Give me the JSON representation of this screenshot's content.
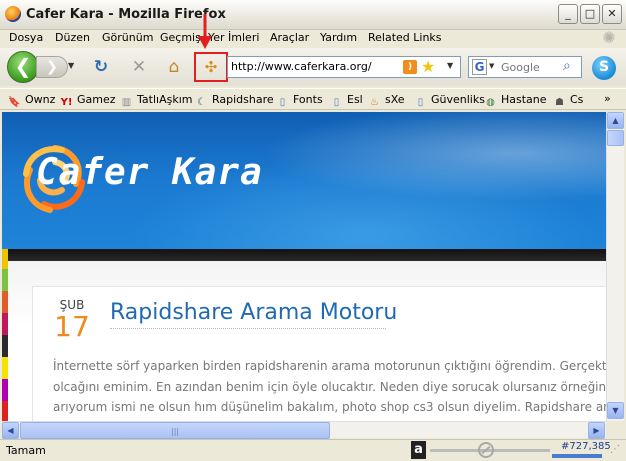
{
  "window": {
    "title": "Cafer Kara - Mozilla Firefox",
    "min": "_",
    "max": "□",
    "close": "✕"
  },
  "menu": [
    "Dosya",
    "Düzen",
    "Görünüm",
    "Geçmiş",
    "Yer İmleri",
    "Araçlar",
    "Yardım",
    "Related Links"
  ],
  "nav": {
    "back": "❮",
    "forward": "❯",
    "dropdown": "▼",
    "reload": "↻",
    "stop": "✕",
    "home": "⌂",
    "url": "http://www.caferkara.org/",
    "rss": ")",
    "star": "★",
    "search_engine": "G",
    "search_placeholder": "Google",
    "search_icon": "⌕",
    "skype": "S"
  },
  "bookmarks": [
    {
      "label": "Ownz",
      "icon": "bookmark-icon"
    },
    {
      "label": "Gamez",
      "icon": "yahoo-icon"
    },
    {
      "label": "TatlıAşkım",
      "icon": "folder-icon"
    },
    {
      "label": "Rapidshare",
      "icon": "moon-icon"
    },
    {
      "label": "Fonts",
      "icon": "page-icon"
    },
    {
      "label": "Esl",
      "icon": "page-icon"
    },
    {
      "label": "sXe",
      "icon": "flame-icon"
    },
    {
      "label": "Güvenliks",
      "icon": "page-icon"
    },
    {
      "label": "Hastane",
      "icon": "globe-icon"
    },
    {
      "label": "Cs",
      "icon": "cs-icon"
    }
  ],
  "bookmarks_more": "»",
  "site": {
    "title": "Cafer Kara",
    "post": {
      "month": "ŞUB",
      "day": "17",
      "title": "Rapidshare Arama Motoru",
      "lines": [
        "İnternette sörf yaparken birden rapidsharenin arama motorunun çıktığını öğrendim. Gerçekten fay",
        "olcağını eminim. En azından benim için öyle olucaktır. Neden diye sorucak olursanız örneğin; bir",
        "arıyorum ismi ne olsun hım düşünelim bakalım, photo shop cs3 olsun diyelim. Rapidshare aramı"
      ]
    }
  },
  "status": {
    "text": "Tamam",
    "alexa": "a",
    "rank": "#727,385"
  },
  "colors": {
    "accent_red": "#e02020",
    "header_blue": "#1b7ad0",
    "date_orange": "#ef8a1e",
    "title_blue": "#1f6ab0"
  }
}
